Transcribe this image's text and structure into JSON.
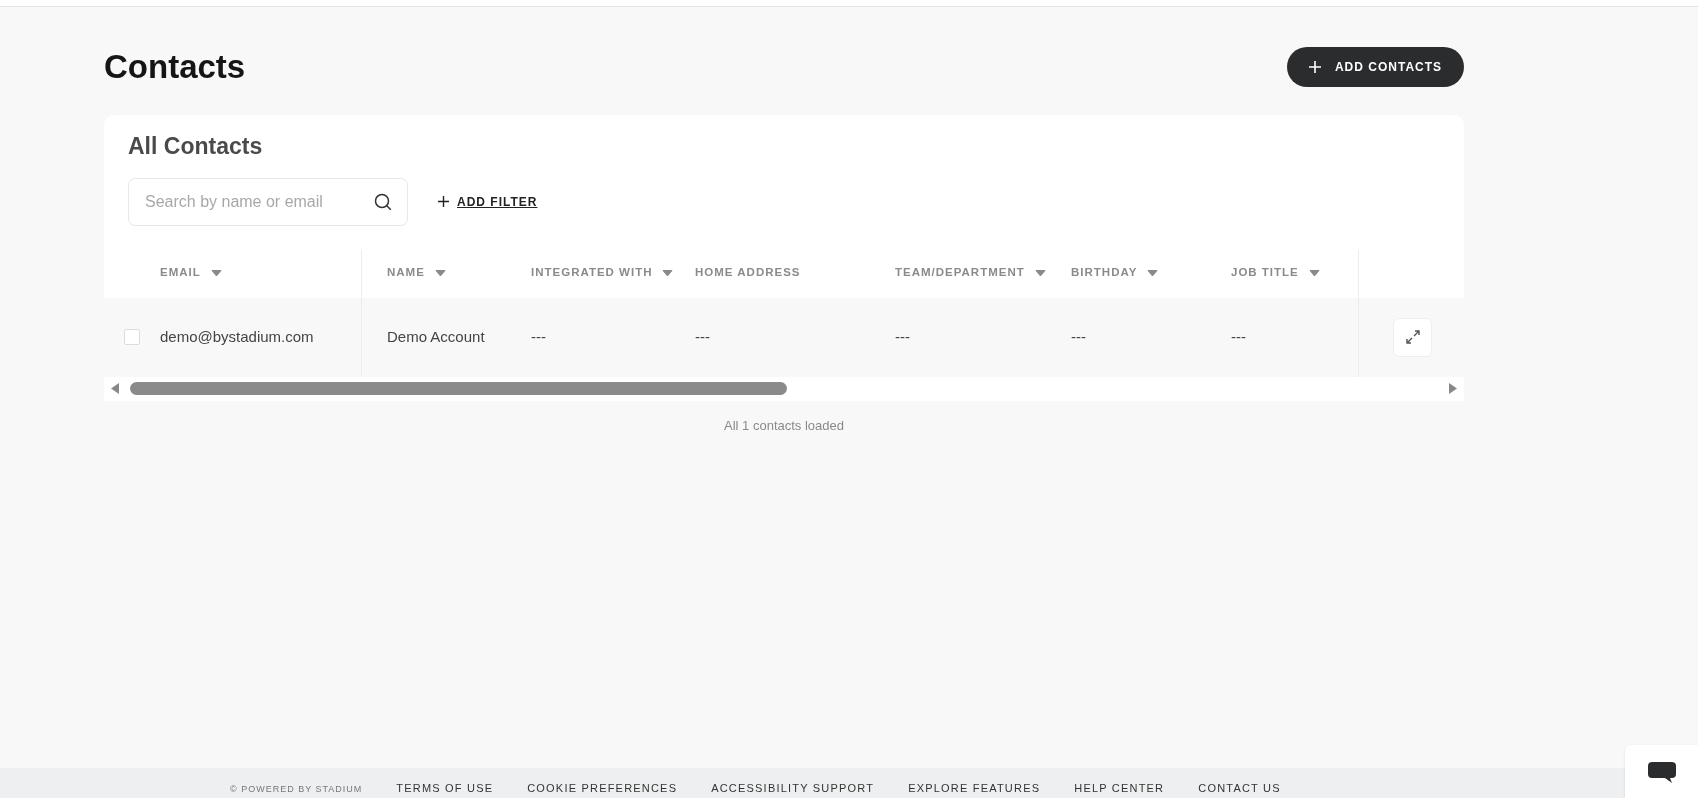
{
  "page_title": "Contacts",
  "add_button": {
    "label": "ADD CONTACTS"
  },
  "card": {
    "title": "All Contacts",
    "search": {
      "placeholder": "Search by name or email"
    },
    "filter_link": "ADD FILTER"
  },
  "table": {
    "columns": [
      {
        "label": "EMAIL",
        "sortable": true
      },
      {
        "label": "NAME",
        "sortable": true
      },
      {
        "label": "INTEGRATED WITH",
        "sortable": true
      },
      {
        "label": "HOME ADDRESS",
        "sortable": false
      },
      {
        "label": "TEAM/DEPARTMENT",
        "sortable": true
      },
      {
        "label": "BIRTHDAY",
        "sortable": true
      },
      {
        "label": "JOB TITLE",
        "sortable": true
      }
    ],
    "rows": [
      {
        "checked": false,
        "cells": [
          "demo@bystadium.com",
          "Demo Account",
          "---",
          "---",
          "---",
          "---",
          "---"
        ]
      }
    ]
  },
  "status": "All 1 contacts loaded",
  "footer": {
    "powered": "© POWERED BY STADIUM",
    "links": [
      "TERMS OF USE",
      "COOKIE PREFERENCES",
      "ACCESSIBILITY SUPPORT",
      "EXPLORE FEATURES",
      "HELP CENTER",
      "CONTACT US"
    ]
  }
}
